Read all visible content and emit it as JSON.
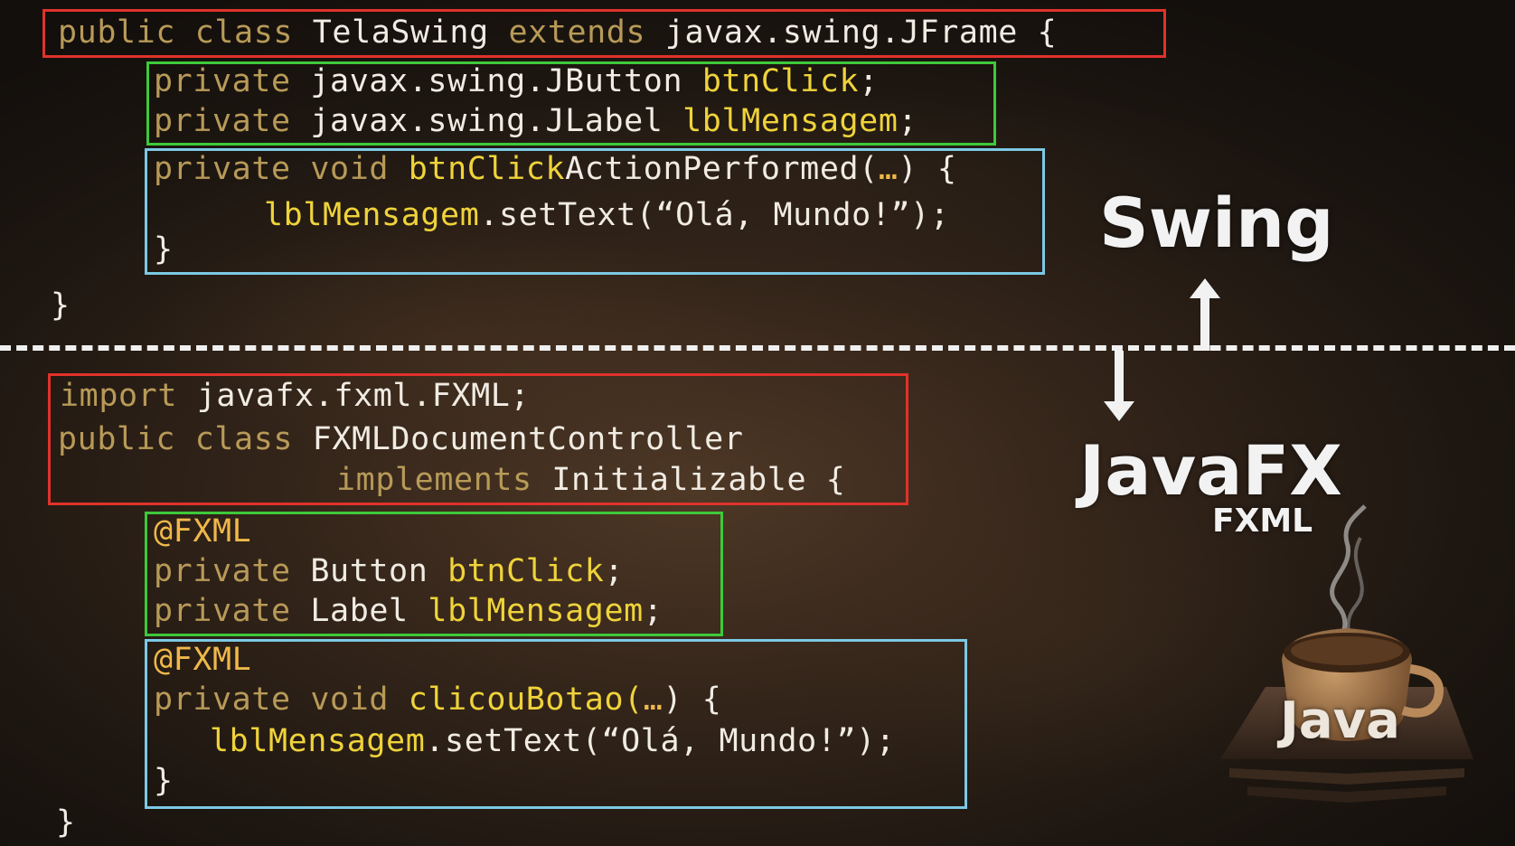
{
  "swing": {
    "line1": {
      "a": "public class ",
      "b": "TelaSwing ",
      "c": "extends ",
      "d": "javax.swing.JFrame {"
    },
    "field1": {
      "a": "private ",
      "b": "javax.swing.JButton ",
      "c": "btnClick",
      ";": ";"
    },
    "field2": {
      "a": "private ",
      "b": "javax.swing.JLabel ",
      "c": "lblMensagem",
      ";": ";"
    },
    "method1": {
      "a": "private void ",
      "b": "btnClick",
      "c": "ActionPerformed(",
      "dots": "…",
      "d": ") {"
    },
    "method2": {
      "a": "lblMensagem",
      ".": ".setText(“Olá, Mundo!”);"
    },
    "method3": "}",
    "close": "}"
  },
  "javafx": {
    "imp": {
      "a": "import ",
      "b": "javafx.fxml.FXML;"
    },
    "cls1": {
      "a": "public class ",
      "b": "FXMLDocumentController"
    },
    "cls2": {
      "a": "implements ",
      "b": "Initializable {"
    },
    "ann1": "@FXML",
    "f1": {
      "a": "private ",
      "b": "Button ",
      "c": "btnClick",
      ";": ";"
    },
    "f2": {
      "a": "private ",
      "b": "Label ",
      "c": "lblMensagem",
      ";": ";"
    },
    "ann2": "@FXML",
    "m1": {
      "a": "private void ",
      "b": "clicouBotao(",
      "dots": "…",
      "c": ") {"
    },
    "m2": {
      "a": "lblMensagem",
      ".": ".setText(“Olá, Mundo!”);"
    },
    "m3": "}",
    "close": "}"
  },
  "labels": {
    "swing": "Swing",
    "javafx": "JavaFX",
    "fxml": "FXML",
    "java": "Java"
  },
  "colors": {
    "red_box": "#e0322b",
    "green_box": "#3ec93a",
    "cyan_box": "#7cc9e4",
    "keyword": "#b89a58",
    "identifier": "#efd33a"
  }
}
